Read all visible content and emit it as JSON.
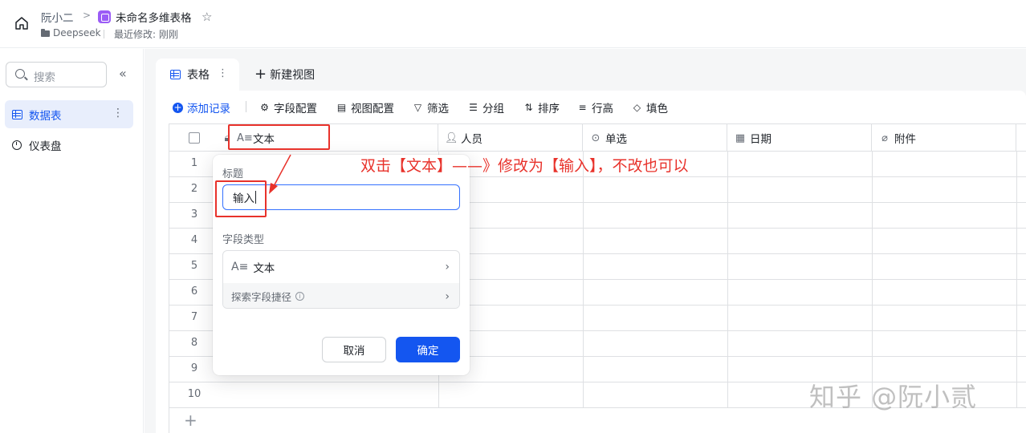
{
  "breadcrumb": {
    "user": "阮小二",
    "doc_title": "未命名多维表格",
    "folder": "Deepseek",
    "last_modified": "最近修改: 刚刚"
  },
  "sidebar": {
    "search_placeholder": "搜索",
    "items": [
      {
        "label": "数据表",
        "icon": "table-icon",
        "active": true
      },
      {
        "label": "仪表盘",
        "icon": "dashboard-icon",
        "active": false
      }
    ]
  },
  "tabs": {
    "active_label": "表格",
    "new_view_label": "新建视图"
  },
  "toolbar": {
    "add_record": "添加记录",
    "field_config": "字段配置",
    "view_config": "视图配置",
    "filter": "筛选",
    "group": "分组",
    "sort": "排序",
    "row_height": "行高",
    "fill_color": "填色"
  },
  "grid": {
    "columns": [
      {
        "label": "文本",
        "icon": "text-field-icon"
      },
      {
        "label": "人员",
        "icon": "person-icon"
      },
      {
        "label": "单选",
        "icon": "single-select-icon"
      },
      {
        "label": "日期",
        "icon": "calendar-icon"
      },
      {
        "label": "附件",
        "icon": "paperclip-icon"
      }
    ],
    "row_numbers": [
      "1",
      "2",
      "3",
      "4",
      "5",
      "6",
      "7",
      "8",
      "9",
      "10"
    ]
  },
  "popup": {
    "title_label": "标题",
    "title_value": "输入",
    "field_type_label": "字段类型",
    "field_type_value": "文本",
    "explore_label": "探索字段捷径",
    "cancel_label": "取消",
    "confirm_label": "确定"
  },
  "annotation": {
    "text": "双击【文本】——》修改为【输入】，不改也可以",
    "color": "#e8322b"
  },
  "watermark": "知乎 @阮小贰",
  "colors": {
    "accent": "#1456f0",
    "annotation_red": "#e8322b"
  }
}
